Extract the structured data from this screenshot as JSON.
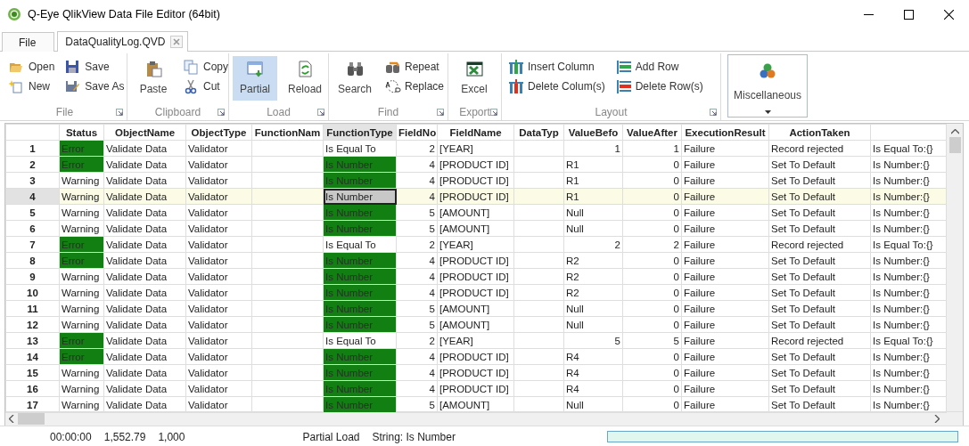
{
  "window": {
    "title": "Q-Eye QlikView Data File Editor (64bit)"
  },
  "tabs": [
    {
      "label": "File",
      "selected": false,
      "closable": false
    },
    {
      "label": "DataQualityLog.QVD",
      "selected": true,
      "closable": true
    }
  ],
  "ribbon": {
    "groups": [
      {
        "label": "File",
        "launcher": true,
        "items": [
          {
            "kind": "stack",
            "buttons": [
              {
                "label": "Open",
                "pressed": false
              },
              {
                "label": "New",
                "pressed": false
              }
            ]
          },
          {
            "kind": "stack",
            "buttons": [
              {
                "label": "Save",
                "pressed": false
              },
              {
                "label": "Save As",
                "pressed": false
              }
            ]
          }
        ]
      },
      {
        "label": "Clipboard",
        "launcher": true,
        "items": [
          {
            "kind": "large",
            "label": "Paste",
            "pressed": false
          },
          {
            "kind": "stack",
            "buttons": [
              {
                "label": "Copy",
                "pressed": false
              },
              {
                "label": "Cut",
                "pressed": false
              }
            ]
          }
        ]
      },
      {
        "label": "Load",
        "launcher": true,
        "items": [
          {
            "kind": "large",
            "label": "Partial",
            "pressed": true
          },
          {
            "kind": "large",
            "label": "Reload",
            "pressed": false
          }
        ]
      },
      {
        "label": "Find",
        "launcher": true,
        "items": [
          {
            "kind": "large",
            "label": "Search",
            "pressed": false
          },
          {
            "kind": "stack",
            "buttons": [
              {
                "label": "Repeat",
                "pressed": false
              },
              {
                "label": "Replace",
                "pressed": false
              }
            ]
          }
        ]
      },
      {
        "label": "Export",
        "launcher": true,
        "items": [
          {
            "kind": "large",
            "label": "Excel",
            "pressed": false
          }
        ]
      },
      {
        "label": "Layout",
        "launcher": true,
        "items": [
          {
            "kind": "stack",
            "buttons": [
              {
                "label": "Insert Column",
                "pressed": false
              },
              {
                "label": "Delete Colum(s)",
                "pressed": false
              }
            ]
          },
          {
            "kind": "stack",
            "buttons": [
              {
                "label": "Add Row",
                "pressed": false
              },
              {
                "label": "Delete Row(s)",
                "pressed": false
              }
            ]
          }
        ]
      },
      {
        "items": [
          {
            "kind": "menu",
            "label": "Miscellaneous",
            "pressed": false
          }
        ]
      }
    ]
  },
  "grid": {
    "columns": [
      {
        "label": "Status",
        "selected": false
      },
      {
        "label": "ObjectName",
        "selected": false
      },
      {
        "label": "ObjectType",
        "selected": false
      },
      {
        "label": "FunctionNam",
        "selected": false
      },
      {
        "label": "FunctionType",
        "selected": true
      },
      {
        "label": "FieldNo",
        "selected": false
      },
      {
        "label": "FieldName",
        "selected": false
      },
      {
        "label": "DataTyp",
        "selected": false
      },
      {
        "label": "ValueBefo",
        "selected": false
      },
      {
        "label": "ValueAfter",
        "selected": false
      },
      {
        "label": "ExecutionResult",
        "selected": false
      },
      {
        "label": "ActionTaken",
        "selected": false
      }
    ],
    "rows": [
      {
        "num": "1",
        "status": "Error",
        "status_flagged": true,
        "object_name": "Validate Data",
        "object_type": "Validator",
        "function_type": "Is Equal To",
        "type_flagged": false,
        "type_focused": false,
        "field_no": "2",
        "field_name": "[YEAR]",
        "value_before": "1",
        "before_numeric": true,
        "value_after": "1",
        "result": "Failure",
        "action": "Record rejected",
        "column_14": "Is Equal To:{}",
        "selected": false
      },
      {
        "num": "2",
        "status": "Error",
        "status_flagged": true,
        "object_name": "Validate Data",
        "object_type": "Validator",
        "function_type": "Is Number",
        "type_flagged": true,
        "type_focused": false,
        "field_no": "4",
        "field_name": "[PRODUCT ID]",
        "value_before": "R1",
        "before_numeric": false,
        "value_after": "0",
        "result": "Failure",
        "action": "Set To Default",
        "column_14": "Is Number:{}",
        "selected": false
      },
      {
        "num": "3",
        "status": "Warning",
        "status_flagged": false,
        "object_name": "Validate Data",
        "object_type": "Validator",
        "function_type": "Is Number",
        "type_flagged": true,
        "type_focused": false,
        "field_no": "4",
        "field_name": "[PRODUCT ID]",
        "value_before": "R1",
        "before_numeric": false,
        "value_after": "0",
        "result": "Failure",
        "action": "Set To Default",
        "column_14": "Is Number:{}",
        "selected": false
      },
      {
        "num": "4",
        "status": "Warning",
        "status_flagged": false,
        "object_name": "Validate Data",
        "object_type": "Validator",
        "function_type": "Is Number",
        "type_flagged": false,
        "type_focused": true,
        "field_no": "4",
        "field_name": "[PRODUCT ID]",
        "value_before": "R1",
        "before_numeric": false,
        "value_after": "0",
        "result": "Failure",
        "action": "Set To Default",
        "column_14": "Is Number:{}",
        "selected": true
      },
      {
        "num": "5",
        "status": "Warning",
        "status_flagged": false,
        "object_name": "Validate Data",
        "object_type": "Validator",
        "function_type": "Is Number",
        "type_flagged": true,
        "type_focused": false,
        "field_no": "5",
        "field_name": "[AMOUNT]",
        "value_before": "Null",
        "before_numeric": false,
        "value_after": "0",
        "result": "Failure",
        "action": "Set To Default",
        "column_14": "Is Number:{}",
        "selected": false
      },
      {
        "num": "6",
        "status": "Warning",
        "status_flagged": false,
        "object_name": "Validate Data",
        "object_type": "Validator",
        "function_type": "Is Number",
        "type_flagged": true,
        "type_focused": false,
        "field_no": "5",
        "field_name": "[AMOUNT]",
        "value_before": "Null",
        "before_numeric": false,
        "value_after": "0",
        "result": "Failure",
        "action": "Set To Default",
        "column_14": "Is Number:{}",
        "selected": false
      },
      {
        "num": "7",
        "status": "Error",
        "status_flagged": true,
        "object_name": "Validate Data",
        "object_type": "Validator",
        "function_type": "Is Equal To",
        "type_flagged": false,
        "type_focused": false,
        "field_no": "2",
        "field_name": "[YEAR]",
        "value_before": "2",
        "before_numeric": true,
        "value_after": "2",
        "result": "Failure",
        "action": "Record rejected",
        "column_14": "Is Equal To:{}",
        "selected": false
      },
      {
        "num": "8",
        "status": "Error",
        "status_flagged": true,
        "object_name": "Validate Data",
        "object_type": "Validator",
        "function_type": "Is Number",
        "type_flagged": true,
        "type_focused": false,
        "field_no": "4",
        "field_name": "[PRODUCT ID]",
        "value_before": "R2",
        "before_numeric": false,
        "value_after": "0",
        "result": "Failure",
        "action": "Set To Default",
        "column_14": "Is Number:{}",
        "selected": false
      },
      {
        "num": "9",
        "status": "Warning",
        "status_flagged": false,
        "object_name": "Validate Data",
        "object_type": "Validator",
        "function_type": "Is Number",
        "type_flagged": true,
        "type_focused": false,
        "field_no": "4",
        "field_name": "[PRODUCT ID]",
        "value_before": "R2",
        "before_numeric": false,
        "value_after": "0",
        "result": "Failure",
        "action": "Set To Default",
        "column_14": "Is Number:{}",
        "selected": false
      },
      {
        "num": "10",
        "status": "Warning",
        "status_flagged": false,
        "object_name": "Validate Data",
        "object_type": "Validator",
        "function_type": "Is Number",
        "type_flagged": true,
        "type_focused": false,
        "field_no": "4",
        "field_name": "[PRODUCT ID]",
        "value_before": "R2",
        "before_numeric": false,
        "value_after": "0",
        "result": "Failure",
        "action": "Set To Default",
        "column_14": "Is Number:{}",
        "selected": false
      },
      {
        "num": "11",
        "status": "Warning",
        "status_flagged": false,
        "object_name": "Validate Data",
        "object_type": "Validator",
        "function_type": "Is Number",
        "type_flagged": true,
        "type_focused": false,
        "field_no": "5",
        "field_name": "[AMOUNT]",
        "value_before": "Null",
        "before_numeric": false,
        "value_after": "0",
        "result": "Failure",
        "action": "Set To Default",
        "column_14": "Is Number:{}",
        "selected": false
      },
      {
        "num": "12",
        "status": "Warning",
        "status_flagged": false,
        "object_name": "Validate Data",
        "object_type": "Validator",
        "function_type": "Is Number",
        "type_flagged": true,
        "type_focused": false,
        "field_no": "5",
        "field_name": "[AMOUNT]",
        "value_before": "Null",
        "before_numeric": false,
        "value_after": "0",
        "result": "Failure",
        "action": "Set To Default",
        "column_14": "Is Number:{}",
        "selected": false
      },
      {
        "num": "13",
        "status": "Error",
        "status_flagged": true,
        "object_name": "Validate Data",
        "object_type": "Validator",
        "function_type": "Is Equal To",
        "type_flagged": false,
        "type_focused": false,
        "field_no": "2",
        "field_name": "[YEAR]",
        "value_before": "5",
        "before_numeric": true,
        "value_after": "5",
        "result": "Failure",
        "action": "Record rejected",
        "column_14": "Is Equal To:{}",
        "selected": false
      },
      {
        "num": "14",
        "status": "Error",
        "status_flagged": true,
        "object_name": "Validate Data",
        "object_type": "Validator",
        "function_type": "Is Number",
        "type_flagged": true,
        "type_focused": false,
        "field_no": "4",
        "field_name": "[PRODUCT ID]",
        "value_before": "R4",
        "before_numeric": false,
        "value_after": "0",
        "result": "Failure",
        "action": "Set To Default",
        "column_14": "Is Number:{}",
        "selected": false
      },
      {
        "num": "15",
        "status": "Warning",
        "status_flagged": false,
        "object_name": "Validate Data",
        "object_type": "Validator",
        "function_type": "Is Number",
        "type_flagged": true,
        "type_focused": false,
        "field_no": "4",
        "field_name": "[PRODUCT ID]",
        "value_before": "R4",
        "before_numeric": false,
        "value_after": "0",
        "result": "Failure",
        "action": "Set To Default",
        "column_14": "Is Number:{}",
        "selected": false
      },
      {
        "num": "16",
        "status": "Warning",
        "status_flagged": false,
        "object_name": "Validate Data",
        "object_type": "Validator",
        "function_type": "Is Number",
        "type_flagged": true,
        "type_focused": false,
        "field_no": "4",
        "field_name": "[PRODUCT ID]",
        "value_before": "R4",
        "before_numeric": false,
        "value_after": "0",
        "result": "Failure",
        "action": "Set To Default",
        "column_14": "Is Number:{}",
        "selected": false
      },
      {
        "num": "17",
        "status": "Warning",
        "status_flagged": false,
        "object_name": "Validate Data",
        "object_type": "Validator",
        "function_type": "Is Number",
        "type_flagged": true,
        "type_focused": false,
        "field_no": "5",
        "field_name": "[AMOUNT]",
        "value_before": "Null",
        "before_numeric": false,
        "value_after": "0",
        "result": "Failure",
        "action": "Set To Default",
        "column_14": "Is Number:{}",
        "selected": false
      }
    ]
  },
  "status_bar": {
    "elapsed": "00:00:00",
    "size": "1,552.79",
    "records": "1,000",
    "mode": "Partial Load",
    "info": "String: Is Number",
    "progress": {
      "level": 1
    }
  }
}
